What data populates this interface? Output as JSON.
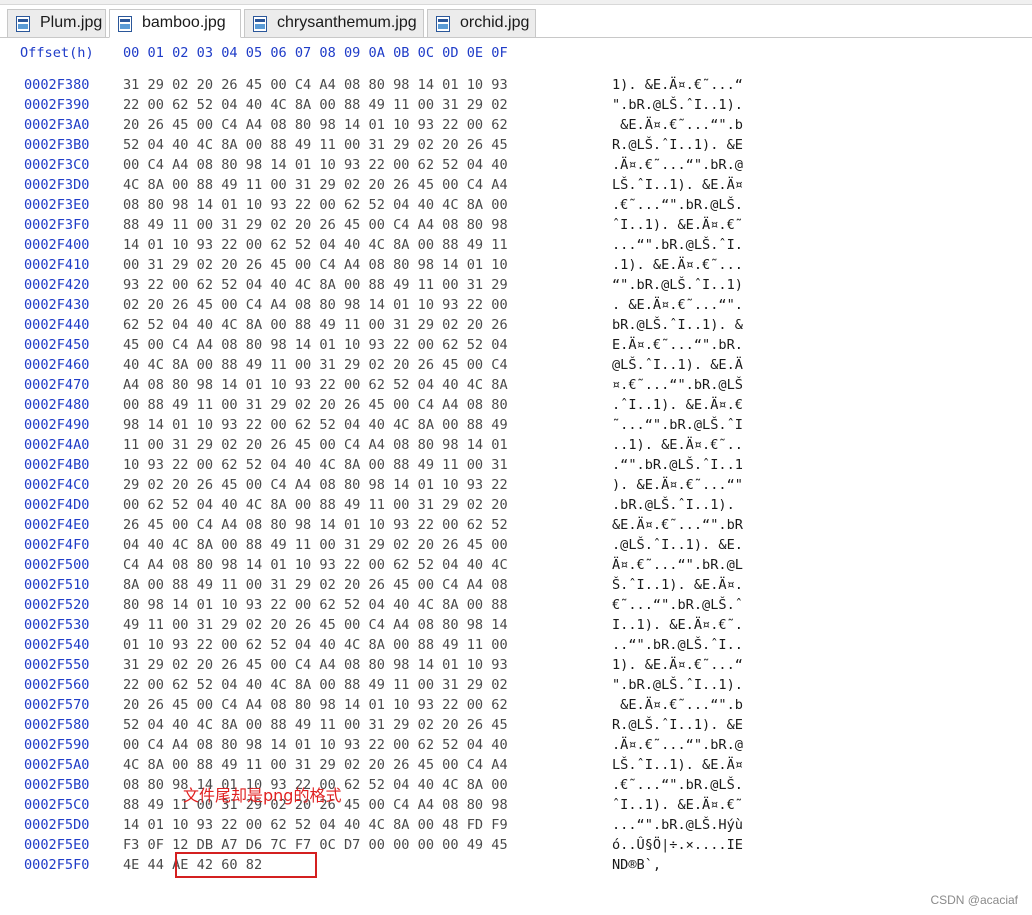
{
  "tabs": [
    {
      "label": "Plum.jpg",
      "icon": "file-icon"
    },
    {
      "label": "bamboo.jpg",
      "icon": "file-icon",
      "active": true
    },
    {
      "label": "chrysanthemum.jpg",
      "icon": "file-icon"
    },
    {
      "label": "orchid.jpg",
      "icon": "file-icon"
    }
  ],
  "header": {
    "offset_label": "Offset(h)",
    "columns": "00 01 02 03 04 05 06 07 08 09 0A 0B 0C 0D 0E 0F"
  },
  "rows": [
    {
      "offset": "0002F380",
      "bytes": "31 29 02 20 26 45 00 C4 A4 08 80 98 14 01 10 93",
      "ascii": "1). &E.Ä¤.€˜...“"
    },
    {
      "offset": "0002F390",
      "bytes": "22 00 62 52 04 40 4C 8A 00 88 49 11 00 31 29 02",
      "ascii": "\".bR.@LŠ.ˆI..1)."
    },
    {
      "offset": "0002F3A0",
      "bytes": "20 26 45 00 C4 A4 08 80 98 14 01 10 93 22 00 62",
      "ascii": " &E.Ä¤.€˜...“\".b"
    },
    {
      "offset": "0002F3B0",
      "bytes": "52 04 40 4C 8A 00 88 49 11 00 31 29 02 20 26 45",
      "ascii": "R.@LŠ.ˆI..1). &E"
    },
    {
      "offset": "0002F3C0",
      "bytes": "00 C4 A4 08 80 98 14 01 10 93 22 00 62 52 04 40",
      "ascii": ".Ä¤.€˜...“\".bR.@"
    },
    {
      "offset": "0002F3D0",
      "bytes": "4C 8A 00 88 49 11 00 31 29 02 20 26 45 00 C4 A4",
      "ascii": "LŠ.ˆI..1). &E.Ä¤"
    },
    {
      "offset": "0002F3E0",
      "bytes": "08 80 98 14 01 10 93 22 00 62 52 04 40 4C 8A 00",
      "ascii": ".€˜...“\".bR.@LŠ."
    },
    {
      "offset": "0002F3F0",
      "bytes": "88 49 11 00 31 29 02 20 26 45 00 C4 A4 08 80 98",
      "ascii": "ˆI..1). &E.Ä¤.€˜"
    },
    {
      "offset": "0002F400",
      "bytes": "14 01 10 93 22 00 62 52 04 40 4C 8A 00 88 49 11",
      "ascii": "...“\".bR.@LŠ.ˆI."
    },
    {
      "offset": "0002F410",
      "bytes": "00 31 29 02 20 26 45 00 C4 A4 08 80 98 14 01 10",
      "ascii": ".1). &E.Ä¤.€˜..."
    },
    {
      "offset": "0002F420",
      "bytes": "93 22 00 62 52 04 40 4C 8A 00 88 49 11 00 31 29",
      "ascii": "“\".bR.@LŠ.ˆI..1)"
    },
    {
      "offset": "0002F430",
      "bytes": "02 20 26 45 00 C4 A4 08 80 98 14 01 10 93 22 00",
      "ascii": ". &E.Ä¤.€˜...“\"."
    },
    {
      "offset": "0002F440",
      "bytes": "62 52 04 40 4C 8A 00 88 49 11 00 31 29 02 20 26",
      "ascii": "bR.@LŠ.ˆI..1). &"
    },
    {
      "offset": "0002F450",
      "bytes": "45 00 C4 A4 08 80 98 14 01 10 93 22 00 62 52 04",
      "ascii": "E.Ä¤.€˜...“\".bR."
    },
    {
      "offset": "0002F460",
      "bytes": "40 4C 8A 00 88 49 11 00 31 29 02 20 26 45 00 C4",
      "ascii": "@LŠ.ˆI..1). &E.Ä"
    },
    {
      "offset": "0002F470",
      "bytes": "A4 08 80 98 14 01 10 93 22 00 62 52 04 40 4C 8A",
      "ascii": "¤.€˜...“\".bR.@LŠ"
    },
    {
      "offset": "0002F480",
      "bytes": "00 88 49 11 00 31 29 02 20 26 45 00 C4 A4 08 80",
      "ascii": ".ˆI..1). &E.Ä¤.€"
    },
    {
      "offset": "0002F490",
      "bytes": "98 14 01 10 93 22 00 62 52 04 40 4C 8A 00 88 49",
      "ascii": "˜...“\".bR.@LŠ.ˆI"
    },
    {
      "offset": "0002F4A0",
      "bytes": "11 00 31 29 02 20 26 45 00 C4 A4 08 80 98 14 01",
      "ascii": "..1). &E.Ä¤.€˜.."
    },
    {
      "offset": "0002F4B0",
      "bytes": "10 93 22 00 62 52 04 40 4C 8A 00 88 49 11 00 31",
      "ascii": ".“\".bR.@LŠ.ˆI..1"
    },
    {
      "offset": "0002F4C0",
      "bytes": "29 02 20 26 45 00 C4 A4 08 80 98 14 01 10 93 22",
      "ascii": "). &E.Ä¤.€˜...“\""
    },
    {
      "offset": "0002F4D0",
      "bytes": "00 62 52 04 40 4C 8A 00 88 49 11 00 31 29 02 20",
      "ascii": ".bR.@LŠ.ˆI..1). "
    },
    {
      "offset": "0002F4E0",
      "bytes": "26 45 00 C4 A4 08 80 98 14 01 10 93 22 00 62 52",
      "ascii": "&E.Ä¤.€˜...“\".bR"
    },
    {
      "offset": "0002F4F0",
      "bytes": "04 40 4C 8A 00 88 49 11 00 31 29 02 20 26 45 00",
      "ascii": ".@LŠ.ˆI..1). &E."
    },
    {
      "offset": "0002F500",
      "bytes": "C4 A4 08 80 98 14 01 10 93 22 00 62 52 04 40 4C",
      "ascii": "Ä¤.€˜...“\".bR.@L"
    },
    {
      "offset": "0002F510",
      "bytes": "8A 00 88 49 11 00 31 29 02 20 26 45 00 C4 A4 08",
      "ascii": "Š.ˆI..1). &E.Ä¤."
    },
    {
      "offset": "0002F520",
      "bytes": "80 98 14 01 10 93 22 00 62 52 04 40 4C 8A 00 88",
      "ascii": "€˜...“\".bR.@LŠ.ˆ"
    },
    {
      "offset": "0002F530",
      "bytes": "49 11 00 31 29 02 20 26 45 00 C4 A4 08 80 98 14",
      "ascii": "I..1). &E.Ä¤.€˜."
    },
    {
      "offset": "0002F540",
      "bytes": "01 10 93 22 00 62 52 04 40 4C 8A 00 88 49 11 00",
      "ascii": "..“\".bR.@LŠ.ˆI.."
    },
    {
      "offset": "0002F550",
      "bytes": "31 29 02 20 26 45 00 C4 A4 08 80 98 14 01 10 93",
      "ascii": "1). &E.Ä¤.€˜...“"
    },
    {
      "offset": "0002F560",
      "bytes": "22 00 62 52 04 40 4C 8A 00 88 49 11 00 31 29 02",
      "ascii": "\".bR.@LŠ.ˆI..1)."
    },
    {
      "offset": "0002F570",
      "bytes": "20 26 45 00 C4 A4 08 80 98 14 01 10 93 22 00 62",
      "ascii": " &E.Ä¤.€˜...“\".b"
    },
    {
      "offset": "0002F580",
      "bytes": "52 04 40 4C 8A 00 88 49 11 00 31 29 02 20 26 45",
      "ascii": "R.@LŠ.ˆI..1). &E"
    },
    {
      "offset": "0002F590",
      "bytes": "00 C4 A4 08 80 98 14 01 10 93 22 00 62 52 04 40",
      "ascii": ".Ä¤.€˜...“\".bR.@"
    },
    {
      "offset": "0002F5A0",
      "bytes": "4C 8A 00 88 49 11 00 31 29 02 20 26 45 00 C4 A4",
      "ascii": "LŠ.ˆI..1). &E.Ä¤"
    },
    {
      "offset": "0002F5B0",
      "bytes": "08 80 98 14 01 10 93 22 00 62 52 04 40 4C 8A 00",
      "ascii": ".€˜...“\".bR.@LŠ."
    },
    {
      "offset": "0002F5C0",
      "bytes": "88 49 11 00 31 29 02 20 26 45 00 C4 A4 08 80 98",
      "ascii": "ˆI..1). &E.Ä¤.€˜"
    },
    {
      "offset": "0002F5D0",
      "bytes": "14 01 10 93 22 00 62 52 04 40 4C 8A 00 48 FD F9",
      "ascii": "...“\".bR.@LŠ.Hýù"
    },
    {
      "offset": "0002F5E0",
      "bytes": "F3 0F 12 DB A7 D6 7C F7 0C D7 00 00 00 00 49 45",
      "ascii": "ó..Û§Ö|÷.×....IE"
    },
    {
      "offset": "0002F5F0",
      "bytes": "4E 44 AE 42 60 82",
      "ascii": "ND®B`‚"
    }
  ],
  "annotation": {
    "text": "文件尾却是png的格式",
    "color": "#e02020"
  },
  "watermark": "CSDN @acaciaf",
  "colors": {
    "offset_text": "#1f3cc8",
    "byte_text": "#4a4a4a",
    "highlight_border": "#d42020"
  }
}
